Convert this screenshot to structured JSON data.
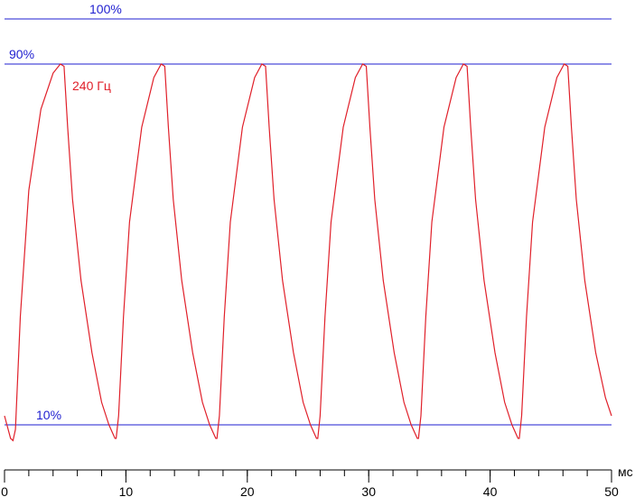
{
  "chart_data": {
    "type": "line",
    "title": "",
    "xlabel": "мс",
    "ylabel": "",
    "xlim": [
      0,
      50
    ],
    "ylim": [
      0,
      105
    ],
    "x_ticks": [
      0,
      10,
      20,
      30,
      40,
      50
    ],
    "minor_tick_step": 2,
    "grid": false,
    "reference_lines": [
      {
        "label": "100%",
        "y": 100
      },
      {
        "label": "90%",
        "y": 90
      },
      {
        "label": "10%",
        "y": 10
      }
    ],
    "series": [
      {
        "name": "240 Гц",
        "color": "#e0202a",
        "x": [
          0,
          0.5,
          0.7,
          0.9,
          1.3,
          2.0,
          3.0,
          4.0,
          4.6,
          4.9,
          5.2,
          5.6,
          6.3,
          7.2,
          8.0,
          8.6,
          9.1,
          9.2,
          9.4,
          9.8,
          10.3,
          11.3,
          12.3,
          12.9,
          13.2,
          13.5,
          13.9,
          14.6,
          15.5,
          16.3,
          16.9,
          17.4,
          17.5,
          17.7,
          18.1,
          18.6,
          19.6,
          20.6,
          21.2,
          21.5,
          21.8,
          22.2,
          22.9,
          23.8,
          24.6,
          25.2,
          25.7,
          25.8,
          26.0,
          26.4,
          26.9,
          27.9,
          28.9,
          29.5,
          29.8,
          30.1,
          30.5,
          31.2,
          32.1,
          32.9,
          33.5,
          34.0,
          34.1,
          34.3,
          34.7,
          35.2,
          36.2,
          37.2,
          37.8,
          38.1,
          38.4,
          38.8,
          39.5,
          40.4,
          41.2,
          41.8,
          42.3,
          42.4,
          42.6,
          43.0,
          43.5,
          44.5,
          45.5,
          46.1,
          46.4,
          46.7,
          47.1,
          47.8,
          48.7,
          49.5,
          50.0
        ],
        "y": [
          12,
          7,
          6.5,
          9,
          34,
          62,
          80,
          88,
          90,
          89.5,
          76,
          60,
          42,
          26,
          15,
          10,
          7,
          7,
          12,
          34,
          55,
          76,
          87,
          90,
          89.5,
          76,
          60,
          42,
          26,
          15,
          10,
          7,
          7,
          12,
          34,
          55,
          76,
          87,
          90,
          89.5,
          76,
          60,
          42,
          26,
          15,
          10,
          7,
          7,
          12,
          34,
          55,
          76,
          87,
          90,
          89.5,
          76,
          60,
          42,
          26,
          15,
          10,
          7,
          7,
          12,
          34,
          55,
          76,
          87,
          90,
          89.5,
          76,
          60,
          42,
          26,
          15,
          10,
          7,
          7,
          12,
          34,
          55,
          76,
          87,
          90,
          89.5,
          76,
          60,
          42,
          26,
          16,
          12
        ]
      }
    ]
  }
}
